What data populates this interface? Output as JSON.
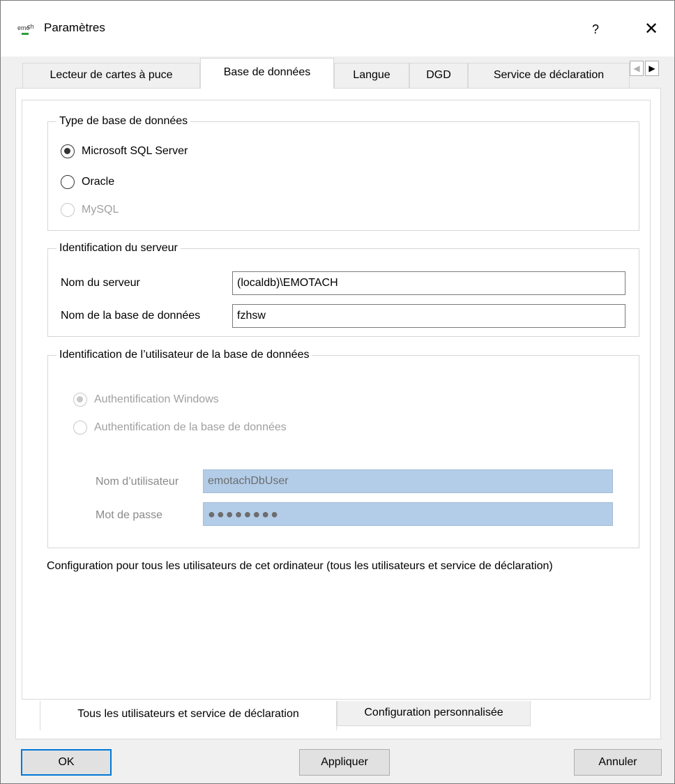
{
  "window": {
    "title": "Paramètres",
    "help_label": "?",
    "close_label": "✕",
    "icon": "emotach-app-icon"
  },
  "tabs": [
    {
      "label": "Lecteur de cartes à puce"
    },
    {
      "label": "Base de données"
    },
    {
      "label": "Langue"
    },
    {
      "label": "DGD"
    },
    {
      "label": "Service de déclaration"
    }
  ],
  "tab_scroll": {
    "left": "◀",
    "right": "▶"
  },
  "db_type": {
    "title": "Type de base de données",
    "options": [
      {
        "label": "Microsoft SQL Server",
        "checked": true,
        "enabled": true
      },
      {
        "label": "Oracle",
        "checked": false,
        "enabled": true
      },
      {
        "label": "MySQL",
        "checked": false,
        "enabled": false
      }
    ]
  },
  "server": {
    "title": "Identification du serveur",
    "server_name_label": "Nom du serveur",
    "server_name_value": "(localdb)\\EMOTACH",
    "db_name_label": "Nom de la base de données",
    "db_name_value": "fzhsw"
  },
  "user_auth": {
    "title": "Identification de l’utilisateur de la base de données",
    "options": [
      {
        "label": "Authentification Windows",
        "checked": true,
        "enabled": false
      },
      {
        "label": "Authentification de la base de données",
        "checked": false,
        "enabled": false
      }
    ],
    "username_label": "Nom d’utilisateur",
    "username_value": "emotachDbUser",
    "password_label": "Mot de passe",
    "password_value": "●●●●●●●●"
  },
  "note": "Configuration pour tous les utilisateurs de cet ordinateur (tous les utilisateurs et service de déclaration)",
  "bottom_tabs": [
    {
      "label": "Tous les utilisateurs et service de déclaration"
    },
    {
      "label": "Configuration personnalisée"
    }
  ],
  "buttons": {
    "ok": "OK",
    "apply": "Appliquer",
    "cancel": "Annuler"
  },
  "colors": {
    "accent": "#0078d7",
    "disabled_field": "#b3cde8"
  }
}
